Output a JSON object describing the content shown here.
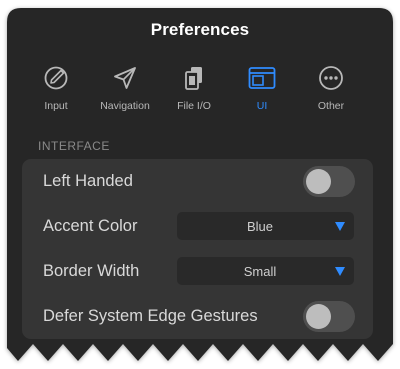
{
  "title": "Preferences",
  "tabs": [
    {
      "label": "Input",
      "icon": "pencil-circle-icon",
      "active": false
    },
    {
      "label": "Navigation",
      "icon": "paper-plane-icon",
      "active": false
    },
    {
      "label": "File I/O",
      "icon": "files-icon",
      "active": false
    },
    {
      "label": "UI",
      "icon": "window-layout-icon",
      "active": true
    },
    {
      "label": "Other",
      "icon": "ellipsis-circle-icon",
      "active": false
    }
  ],
  "section": {
    "header": "INTERFACE",
    "rows": [
      {
        "label": "Left Handed",
        "control": "toggle",
        "on": false
      },
      {
        "label": "Accent Color",
        "control": "select",
        "value": "Blue"
      },
      {
        "label": "Border Width",
        "control": "select",
        "value": "Small"
      },
      {
        "label": "Defer System Edge Gestures",
        "control": "toggle",
        "on": false
      }
    ]
  },
  "colors": {
    "panel": "#262626",
    "group": "#353535",
    "accent": "#2f8cff",
    "text": "#d9d9d9",
    "muted": "#b8b8b8"
  }
}
